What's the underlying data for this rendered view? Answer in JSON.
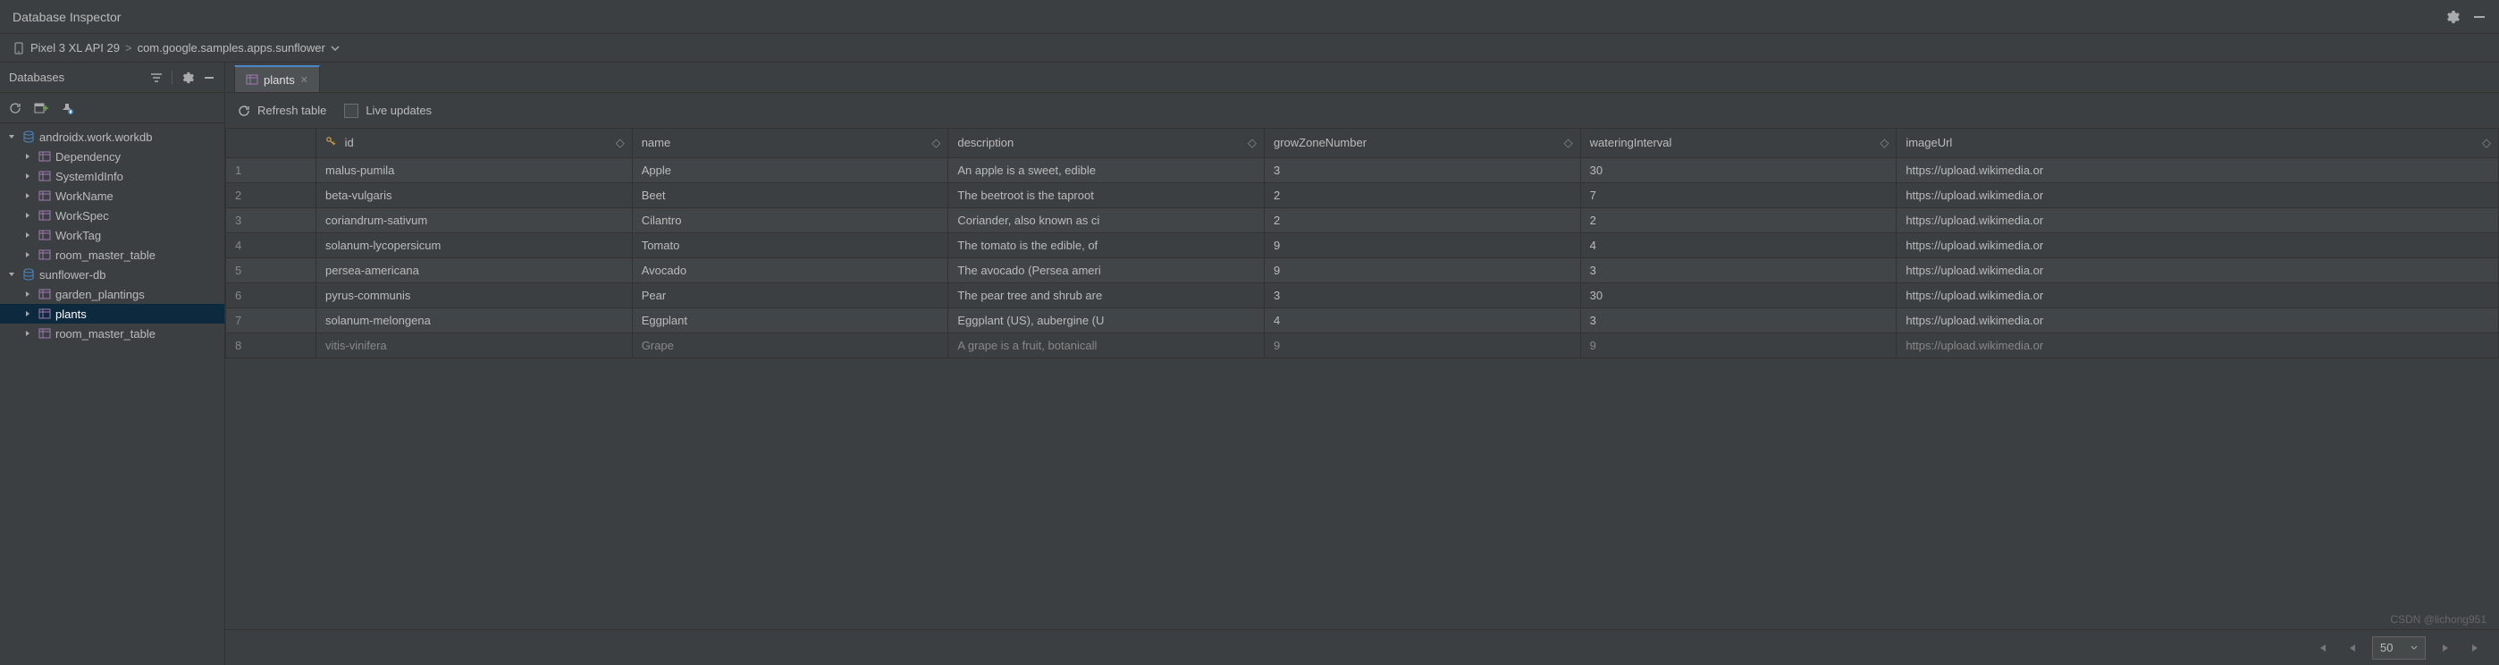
{
  "header": {
    "title": "Database Inspector"
  },
  "breadcrumb": {
    "device": "Pixel 3 XL API 29",
    "sep": ">",
    "app": "com.google.samples.apps.sunflower"
  },
  "sidebar": {
    "title": "Databases",
    "tree": [
      {
        "kind": "db",
        "label": "androidx.work.workdb",
        "expanded": true,
        "level": 0
      },
      {
        "kind": "table",
        "label": "Dependency",
        "level": 1
      },
      {
        "kind": "table",
        "label": "SystemIdInfo",
        "level": 1
      },
      {
        "kind": "table",
        "label": "WorkName",
        "level": 1
      },
      {
        "kind": "table",
        "label": "WorkSpec",
        "level": 1
      },
      {
        "kind": "table",
        "label": "WorkTag",
        "level": 1
      },
      {
        "kind": "table",
        "label": "room_master_table",
        "level": 1
      },
      {
        "kind": "db",
        "label": "sunflower-db",
        "expanded": true,
        "level": 0
      },
      {
        "kind": "table",
        "label": "garden_plantings",
        "level": 1
      },
      {
        "kind": "table",
        "label": "plants",
        "level": 1,
        "selected": true
      },
      {
        "kind": "table",
        "label": "room_master_table",
        "level": 1
      }
    ]
  },
  "tab": {
    "label": "plants"
  },
  "toolbar": {
    "refresh": "Refresh table",
    "live": "Live updates"
  },
  "columns": [
    "id",
    "name",
    "description",
    "growZoneNumber",
    "wateringInterval",
    "imageUrl"
  ],
  "rows": [
    {
      "n": "1",
      "id": "malus-pumila",
      "name": "Apple",
      "description": "An apple is a sweet, edible",
      "gzn": "3",
      "wi": "30",
      "url": "https://upload.wikimedia.or"
    },
    {
      "n": "2",
      "id": "beta-vulgaris",
      "name": "Beet",
      "description": "The beetroot is the taproot",
      "gzn": "2",
      "wi": "7",
      "url": "https://upload.wikimedia.or"
    },
    {
      "n": "3",
      "id": "coriandrum-sativum",
      "name": "Cilantro",
      "description": "Coriander, also known as ci",
      "gzn": "2",
      "wi": "2",
      "url": "https://upload.wikimedia.or"
    },
    {
      "n": "4",
      "id": "solanum-lycopersicum",
      "name": "Tomato",
      "description": "The tomato is the edible, of",
      "gzn": "9",
      "wi": "4",
      "url": "https://upload.wikimedia.or"
    },
    {
      "n": "5",
      "id": "persea-americana",
      "name": "Avocado",
      "description": "The avocado (Persea ameri",
      "gzn": "9",
      "wi": "3",
      "url": "https://upload.wikimedia.or"
    },
    {
      "n": "6",
      "id": "pyrus-communis",
      "name": "Pear",
      "description": "The pear tree and shrub are",
      "gzn": "3",
      "wi": "30",
      "url": "https://upload.wikimedia.or"
    },
    {
      "n": "7",
      "id": "solanum-melongena",
      "name": "Eggplant",
      "description": "Eggplant (US), aubergine (U",
      "gzn": "4",
      "wi": "3",
      "url": "https://upload.wikimedia.or"
    },
    {
      "n": "8",
      "id": "vitis-vinifera",
      "name": "Grape",
      "description": "A grape is a fruit, botanicall",
      "gzn": "9",
      "wi": "9",
      "url": "https://upload.wikimedia.or"
    }
  ],
  "pagination": {
    "pageSize": "50"
  },
  "watermark": "CSDN @lichong951"
}
